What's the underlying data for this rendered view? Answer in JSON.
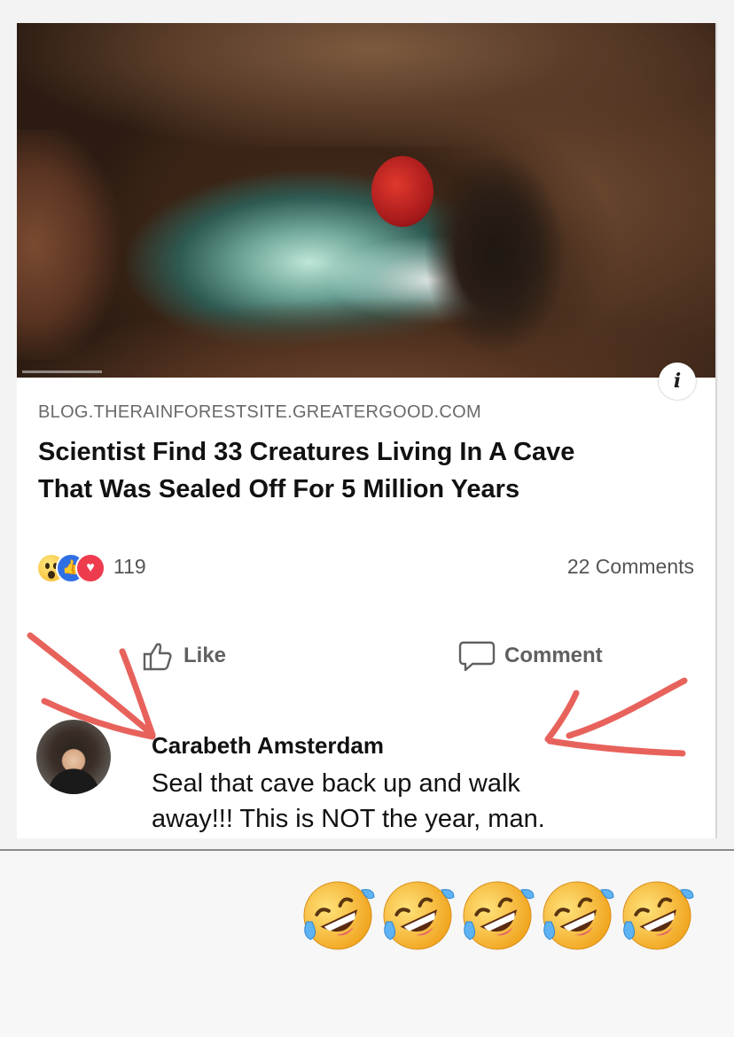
{
  "post": {
    "info_icon": "i",
    "link_domain": "BLOG.THERAINFORESTSITE.GREATERGOOD.COM",
    "link_title_line1": "Scientist Find 33 Creatures Living In A Cave",
    "link_title_line2": "That Was Sealed Off For 5 Million Years"
  },
  "reactions": {
    "icons": [
      "wow-reaction-icon",
      "like-reaction-icon",
      "love-reaction-icon"
    ],
    "count": "119"
  },
  "comments_count": "22 Comments",
  "actions": {
    "like_label": "Like",
    "comment_label": "Comment"
  },
  "comment": {
    "author": "Carabeth Amsterdam",
    "text_line1": "Seal that cave back up and walk",
    "text_line2": "away!!! This is NOT the year, man."
  },
  "annotations": {
    "arrow_color": "#e8625c"
  },
  "caption": {
    "emoji": "rolling-on-floor-laughing",
    "emoji_count": 5
  }
}
